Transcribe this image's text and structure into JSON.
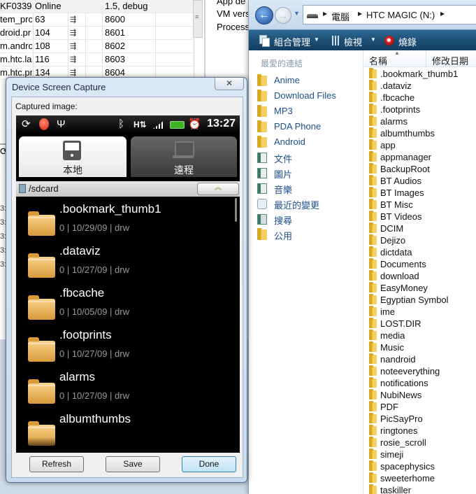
{
  "ddms": {
    "rows": [
      {
        "name": "KF0339",
        "pid": "Online",
        "status": "",
        "port": "1.5, debug"
      },
      {
        "name": "tem_prc",
        "pid": "63",
        "status": "debug-icon",
        "port": "8600"
      },
      {
        "name": "droid.pr",
        "pid": "104",
        "status": "debug-icon",
        "port": "8601"
      },
      {
        "name": "m.andro",
        "pid": "108",
        "status": "debug-icon",
        "port": "8602"
      },
      {
        "name": "m.htc.lau",
        "pid": "116",
        "status": "debug-icon",
        "port": "8603"
      },
      {
        "name": "m.htc.pr",
        "pid": "134",
        "status": "debug-icon",
        "port": "8604"
      }
    ],
    "side_info": [
      "App de",
      "VM vers",
      "Process"
    ],
    "log_fragments": [
      "3:",
      "3:",
      "3:",
      "3:",
      "3:"
    ]
  },
  "explorer": {
    "breadcrumb": [
      "電腦",
      "HTC MAGIC (N:)"
    ],
    "toolbar": {
      "organize": "組合管理",
      "view": "檢視",
      "burn": "燒錄"
    },
    "nav_header": "最愛的連結",
    "nav_items": [
      {
        "label": "Anime",
        "icon": "folder-icon"
      },
      {
        "label": "Download Files",
        "icon": "folder-icon"
      },
      {
        "label": "MP3",
        "icon": "folder-icon"
      },
      {
        "label": "PDA Phone",
        "icon": "folder-icon"
      },
      {
        "label": "Android",
        "icon": "folder-icon"
      },
      {
        "label": "文件",
        "icon": "documents-icon"
      },
      {
        "label": "圖片",
        "icon": "pictures-icon"
      },
      {
        "label": "音樂",
        "icon": "music-icon"
      },
      {
        "label": "最近的變更",
        "icon": "recent-changes-icon"
      },
      {
        "label": "搜尋",
        "icon": "search-icon"
      },
      {
        "label": "公用",
        "icon": "folder-icon"
      }
    ],
    "columns": {
      "name": "名稱",
      "date": "修改日期"
    },
    "files": [
      ".bookmark_thumb1",
      ".dataviz",
      ".fbcache",
      ".footprints",
      "alarms",
      "albumthumbs",
      "app",
      "appmanager",
      "BackupRoot",
      "BT Audios",
      "BT Images",
      "BT Misc",
      "BT Videos",
      "DCIM",
      "Dejizo",
      "dictdata",
      "Documents",
      "download",
      "EasyMoney",
      "Egyptian Symbol",
      "ime",
      "LOST.DIR",
      "media",
      "Music",
      "nandroid",
      "noteeverything",
      "notifications",
      "NubiNews",
      "PDF",
      "PicSayPro",
      "ringtones",
      "rosie_scroll",
      "simeji",
      "spacephysics",
      "sweeterhome",
      "taskiller"
    ]
  },
  "dialog": {
    "title": "Device Screen Capture",
    "close_glyph": "✕",
    "caption": "Captured image:",
    "buttons": {
      "refresh": "Refresh",
      "save": "Save",
      "done": "Done"
    },
    "phone": {
      "time": "13:27",
      "tabs": {
        "local": "本地",
        "remote": "遠程"
      },
      "path": "/sdcard",
      "up_glyph": "︽",
      "items": [
        {
          "name": ".bookmark_thumb1",
          "meta": "0 | 10/29/09 | drw"
        },
        {
          "name": ".dataviz",
          "meta": "0 | 10/27/09 | drw"
        },
        {
          "name": ".fbcache",
          "meta": "0 | 10/05/09 | drw"
        },
        {
          "name": ".footprints",
          "meta": "0 | 10/27/09 | drw"
        },
        {
          "name": "alarms",
          "meta": "0 | 10/27/09 | drw"
        },
        {
          "name": "albumthumbs",
          "meta": ""
        }
      ]
    }
  }
}
